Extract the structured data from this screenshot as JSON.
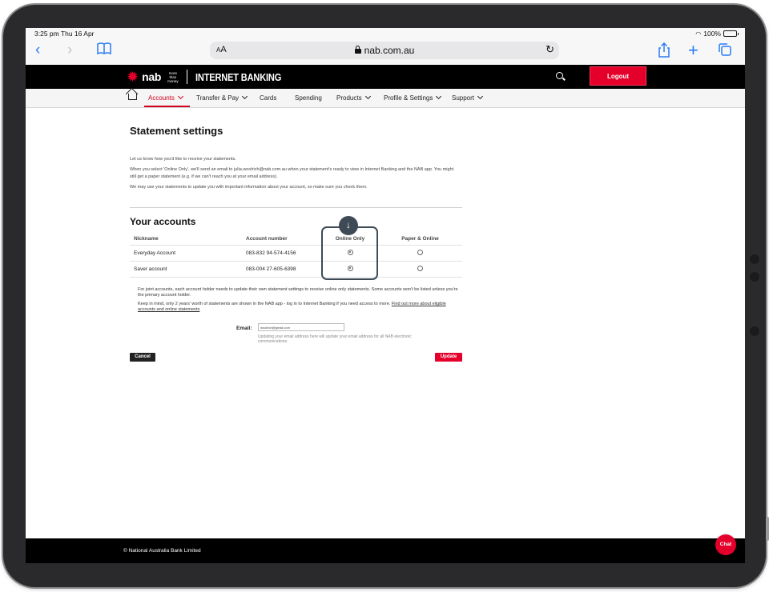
{
  "statusbar": {
    "time_date": "3:25 pm  Thu 16 Apr",
    "battery": "100%"
  },
  "safari": {
    "text_size": "AA",
    "url": "nab.com.au"
  },
  "header": {
    "logo_text": "nab",
    "tagline_line1": "more",
    "tagline_line2": "than",
    "tagline_line3": "money",
    "title": "INTERNET BANKING",
    "logout_label": "Logout"
  },
  "nav": {
    "items": [
      {
        "label": "Accounts"
      },
      {
        "label": "Transfer & Pay"
      },
      {
        "label": "Cards"
      },
      {
        "label": "Spending"
      },
      {
        "label": "Products"
      },
      {
        "label": "Profile & Settings"
      },
      {
        "label": "Support"
      }
    ]
  },
  "page": {
    "title": "Statement settings",
    "intro": [
      "Let us know how you'd like to receive your statements.",
      "When you select 'Online Only', we'll send an email to julia.woolrich@nab.com.au when your statement's ready to view in Internet Banking and the NAB app. You might still get a paper statement (e.g. if we can't reach you at your email address).",
      "We may use your statements to update you with important information about your account, so make sure you check them."
    ],
    "accounts_title": "Your accounts",
    "table": {
      "headers": [
        "Nickname",
        "Account number",
        "Online Only",
        "Paper & Online"
      ],
      "rows": [
        {
          "nickname": "Everyday Account",
          "account_number": "083-832 94-574-4156",
          "selected": "Online Only"
        },
        {
          "nickname": "Saver account",
          "account_number": "083-004 27-605-6398",
          "selected": "Online Only"
        }
      ]
    },
    "note_joint": "For joint accounts, each account holder needs to update their own statement settings to receive online only statements. Some accounts won't be listed unless you're the primary account holder.",
    "note_history": "Keep in mind, only 2 years' worth of statements are shown in the NAB app - log in to Internet Banking if you need access to more.",
    "note_link": "Find out more about eligible accounts and online statements",
    "email_label": "Email:",
    "email_value": "woolrich@gmail.com",
    "email_help": "Updating your email address here will update your email address for all NAB electronic communications.",
    "cancel_label": "Cancel",
    "update_label": "Update",
    "highlight_badge": "↓"
  },
  "footer": {
    "copyright": "© National Australia Bank Limited"
  },
  "chat": {
    "label": "Chat"
  },
  "colors": {
    "brand_red": "#e4002b",
    "header_black": "#000000",
    "highlight": "#3e4b56"
  }
}
